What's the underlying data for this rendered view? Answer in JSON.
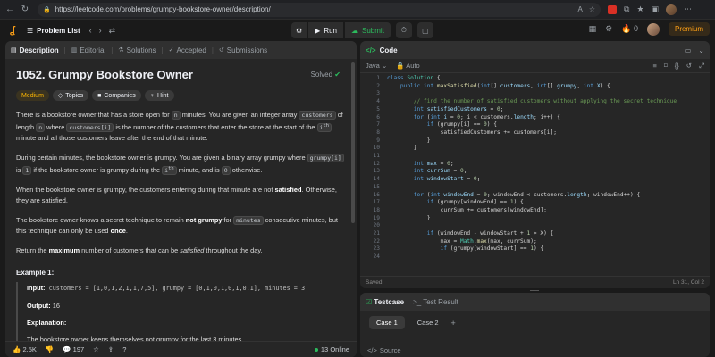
{
  "browser": {
    "url": "https://leetcode.com/problems/grumpy-bookstore-owner/description/",
    "zoom_text": "A"
  },
  "nav": {
    "problem_list": "Problem List",
    "run": "Run",
    "submit": "Submit",
    "streak": "0",
    "premium": "Premium"
  },
  "left_tabs": [
    "Description",
    "Editorial",
    "Solutions",
    "Accepted",
    "Submissions"
  ],
  "problem": {
    "title": "1052. Grumpy Bookstore Owner",
    "solved": "Solved",
    "difficulty": "Medium",
    "badges": [
      "Topics",
      "Companies",
      "Hint"
    ],
    "p1_a": "There is a bookstore owner that has a store open for ",
    "p1_n": "n",
    "p1_b": " minutes. You are given an integer array ",
    "p1_customers": "customers",
    "p1_c": " of length ",
    "p1_n2": "n",
    "p1_d": " where ",
    "p1_ci": "customers[i]",
    "p1_e": " is the number of the customers that enter the store at the start of the ",
    "p1_ith": "i",
    "p1_th": "th",
    "p1_f": " minute and all those customers leave after the end of that minute.",
    "p2_a": "During certain minutes, the bookstore owner is grumpy. You are given a binary array grumpy where ",
    "p2_gi": "grumpy[i]",
    "p2_b": " is ",
    "p2_one": "1",
    "p2_c": " if the bookstore owner is grumpy during the ",
    "p2_ith": "i",
    "p2_th": "th",
    "p2_d": " minute, and is ",
    "p2_zero": "0",
    "p2_e": " otherwise.",
    "p3_a": "When the bookstore owner is grumpy, the customers entering during that minute are not ",
    "p3_bold": "satisfied",
    "p3_b": ". Otherwise, they are satisfied.",
    "p4_a": "The bookstore owner knows a secret technique to remain ",
    "p4_bold": "not grumpy",
    "p4_b": " for ",
    "p4_minutes": "minutes",
    "p4_c": " consecutive minutes, but this technique can only be used ",
    "p4_once": "once",
    "p4_d": ".",
    "p5_a": "Return the ",
    "p5_bold": "maximum",
    "p5_b": " number of customers that can be ",
    "p5_it": "satisfied",
    "p5_c": " throughout the day.",
    "example_title": "Example 1:",
    "ex_input_label": "Input:",
    "ex_input": " customers = [1,0,1,2,1,1,7,5], grumpy = [0,1,0,1,0,1,0,1], minutes = 3",
    "ex_output_label": "Output:",
    "ex_output": " 16",
    "ex_expl_label": "Explanation:",
    "ex_expl": "The bookstore owner keeps themselves not grumpy for the last 3 minutes."
  },
  "footer": {
    "likes": "2.5K",
    "comments": "197",
    "online": "13 Online"
  },
  "code_panel": {
    "title": "Code",
    "language": "Java",
    "auto": "Auto",
    "status_left": "Saved",
    "status_right": "Ln 31, Col 2"
  },
  "test_panel": {
    "testcase": "Testcase",
    "result": "Test Result",
    "case1": "Case 1",
    "case2": "Case 2",
    "source": "Source"
  }
}
